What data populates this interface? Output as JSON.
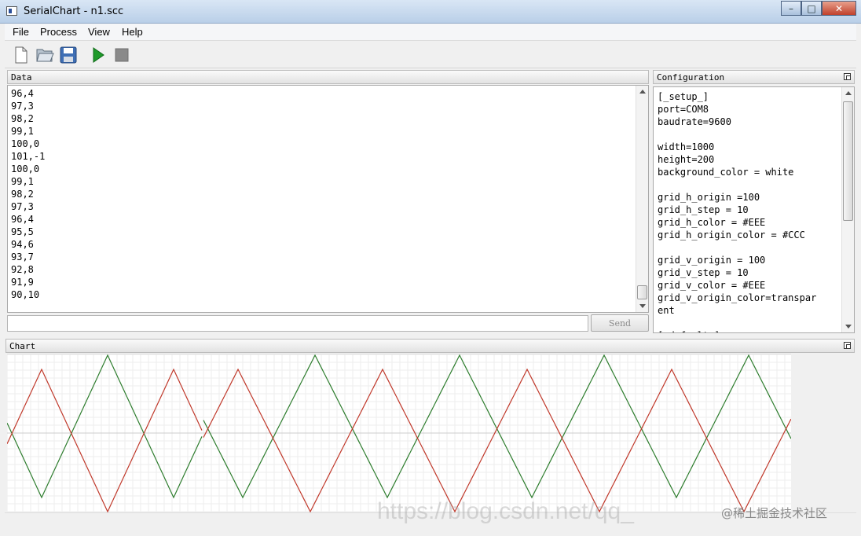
{
  "window": {
    "title": "SerialChart - n1.scc"
  },
  "menu": {
    "file": "File",
    "process": "Process",
    "view": "View",
    "help": "Help"
  },
  "panels": {
    "data": "Data",
    "configuration": "Configuration",
    "chart": "Chart"
  },
  "data_lines": [
    "96,4",
    "97,3",
    "98,2",
    "99,1",
    "100,0",
    "101,-1",
    "100,0",
    "99,1",
    "98,2",
    "97,3",
    "96,4",
    "95,5",
    "94,6",
    "93,7",
    "92,8",
    "91,9",
    "90,10"
  ],
  "config_lines": [
    "[_setup_]",
    "port=COM8",
    "baudrate=9600",
    "",
    "width=1000",
    "height=200",
    "background_color = white",
    "",
    "grid_h_origin =100",
    "grid_h_step = 10",
    "grid_h_color = #EEE",
    "grid_h_origin_color = #CCC",
    "",
    "grid_v_origin = 100",
    "grid_v_step = 10",
    "grid_v_color = #EEE",
    "grid_v_origin_color=transpar",
    "ent",
    "",
    "[_default_]"
  ],
  "send": {
    "button_label": "Send",
    "input_value": ""
  },
  "colors": {
    "series_green": "#2e7d2e",
    "series_red": "#c0392b",
    "grid": "#eeeeee",
    "grid_origin": "#cccccc"
  },
  "chart_data": {
    "type": "line",
    "series": [
      {
        "color": "#2e7d2e",
        "description": "triangle wave 0..100",
        "period": 180
      },
      {
        "color": "#c0392b",
        "description": "triangle wave offset",
        "period": 180
      }
    ],
    "grid_h_step": 10,
    "grid_v_step": 10,
    "grid_h_origin": 100
  },
  "watermark": {
    "url": "https://blog.csdn.net/qq_",
    "site": "@稀土掘金技术社区"
  },
  "icons": [
    "new-file-icon",
    "open-folder-icon",
    "save-icon",
    "run-icon",
    "stop-icon"
  ]
}
